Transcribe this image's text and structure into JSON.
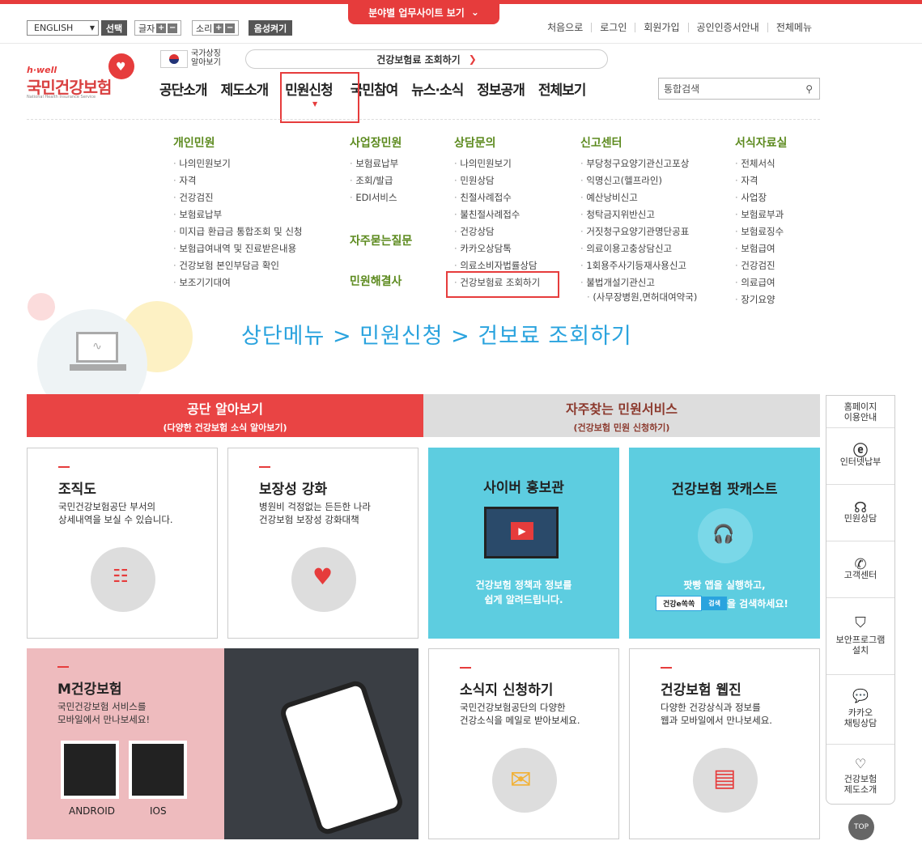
{
  "top": {
    "site_button": "분야별 업무사이트 보기",
    "lang": "ENGLISH",
    "select_btn": "선택",
    "font_label": "글자",
    "sound_label": "소리",
    "voice_btn": "음성켜기",
    "links": [
      "처음으로",
      "로그인",
      "회원가입",
      "공인인증서안내",
      "전체메뉴"
    ]
  },
  "logo": {
    "brand": "h·well",
    "name": "국민건강보험",
    "sub": "National Health Insurance Service"
  },
  "symbol": "국가상징\n알아보기",
  "banner": "건강보험료 조회하기",
  "gnb": [
    "공단소개",
    "제도소개",
    "민원신청",
    "국민참여",
    "뉴스·소식",
    "정보공개",
    "전체보기"
  ],
  "search_placeholder": "통합검색",
  "menu": {
    "col1": {
      "title": "개인민원",
      "items": [
        "나의민원보기",
        "자격",
        "건강검진",
        "보험료납부",
        "미지급 환급금 통합조회 및 신청",
        "보험급여내역 및 진료받은내용",
        "건강보험 본인부담금 확인",
        "보조기기대여"
      ]
    },
    "col2": {
      "title": "사업장민원",
      "items": [
        "보험료납부",
        "조회/발급",
        "EDI서비스"
      ],
      "title2": "자주묻는질문",
      "title3": "민원해결사"
    },
    "col3": {
      "title": "상담문의",
      "items": [
        "나의민원보기",
        "민원상담",
        "친절사례접수",
        "불친절사례접수",
        "건강상담",
        "카카오상담톡",
        "의료소비자법률상담",
        "건강보험료 조회하기"
      ]
    },
    "col4": {
      "title": "신고센터",
      "items": [
        "부당청구요양기관신고포상",
        "익명신고(헬프라인)",
        "예산낭비신고",
        "청탁금지위반신고",
        "거짓청구요양기관명단공표",
        "의료이용고충상담신고",
        "1회용주사기등재사용신고",
        "불법개설기관신고",
        "(사무장병원,면허대여약국)"
      ]
    },
    "col5": {
      "title": "서식자료실",
      "items": [
        "전체서식",
        "자격",
        "사업장",
        "보험료부과",
        "보험료징수",
        "보험급여",
        "건강검진",
        "의료급여",
        "장기요양"
      ]
    }
  },
  "caption": "상단메뉴 > 민원신청 > 건보료 조회하기",
  "tabs": {
    "left_title": "공단 알아보기",
    "left_sub": "(다양한 건강보험 소식 알아보기)",
    "right_title": "자주찾는 민원서비스",
    "right_sub": "(건강보험 민원 신청하기)"
  },
  "cards": {
    "org": {
      "title": "조직도",
      "desc": "국민건강보험공단 부서의\n상세내역을 보실 수 있습니다."
    },
    "guarantee": {
      "title": "보장성 강화",
      "desc": "병원비 걱정없는 든든한 나라\n건강보험 보장성 강화대책"
    },
    "cyber": {
      "title": "사이버 홍보관",
      "desc": "건강보험 정책과 정보를\n쉽게 알려드립니다."
    },
    "podcast": {
      "title": "건강보험 팟캐스트",
      "desc1": "팟빵 앱을 실행하고,",
      "search_text": "건강e쏙쏙",
      "search_btn": "검색",
      "desc2": "을 검색하세요!"
    },
    "mobile": {
      "title": "M건강보험",
      "desc": "국민건강보험 서비스를\n모바일에서 만나보세요!",
      "android": "ANDROID",
      "ios": "IOS"
    },
    "newsletter": {
      "title": "소식지 신청하기",
      "desc": "국민건강보험공단의 다양한\n건강소식을 메일로 받아보세요."
    },
    "webzine": {
      "title": "건강보험 웹진",
      "desc": "다양한 건강상식과 정보를\n웹과 모바일에서 만나보세요."
    }
  },
  "sidebar": [
    "홈페이지\n이용안내",
    "인터넷납부",
    "민원상담",
    "고객센터",
    "보안프로그램\n설치",
    "카카오\n채팅상담",
    "건강보험\n제도소개"
  ],
  "top_btn": "TOP"
}
